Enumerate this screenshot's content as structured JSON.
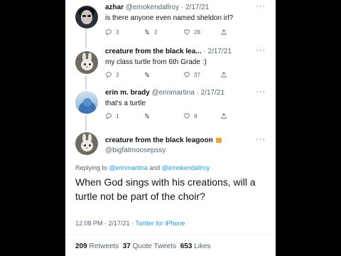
{
  "tweets": [
    {
      "name": "azhar",
      "handle": "@emokendallroy",
      "date": "· 2/17/21",
      "text": "is there anyone even named sheldon irl?",
      "replies": "3",
      "retweets": "2",
      "likes": "28"
    },
    {
      "name": "creature from the black lea...",
      "handle": "",
      "date": "· 2/17/21",
      "text": "my class turtle from 6th Grade :)",
      "replies": "3",
      "retweets": "",
      "likes": "37"
    },
    {
      "name": "erin m. brady",
      "handle": "@erinmartina",
      "date": "· 2/17/21",
      "text": "that's a turtle",
      "replies": "1",
      "retweets": "",
      "likes": "9"
    }
  ],
  "main_tweet": {
    "name": "creature from the black leagoon",
    "handle": "@bigfatmoosepssy",
    "replying_prefix": "Replying to",
    "replying_user1": "@erinmartina",
    "replying_and": "and",
    "replying_user2": "@emokendallroy",
    "text": "When God sings with his creations, will a turtle not be part of the choir?",
    "time": "12:08 PM · 2/17/21 ·",
    "client": "Twitter for iPhone",
    "retweets_count": "209",
    "retweets_label": "Retweets",
    "quotes_count": "37",
    "quotes_label": "Quote Tweets",
    "likes_count": "653",
    "likes_label": "Likes"
  },
  "more_symbol": "···",
  "colors": {
    "accent": "#1d9bf0",
    "secondary": "#536471",
    "text": "#0f1419"
  }
}
